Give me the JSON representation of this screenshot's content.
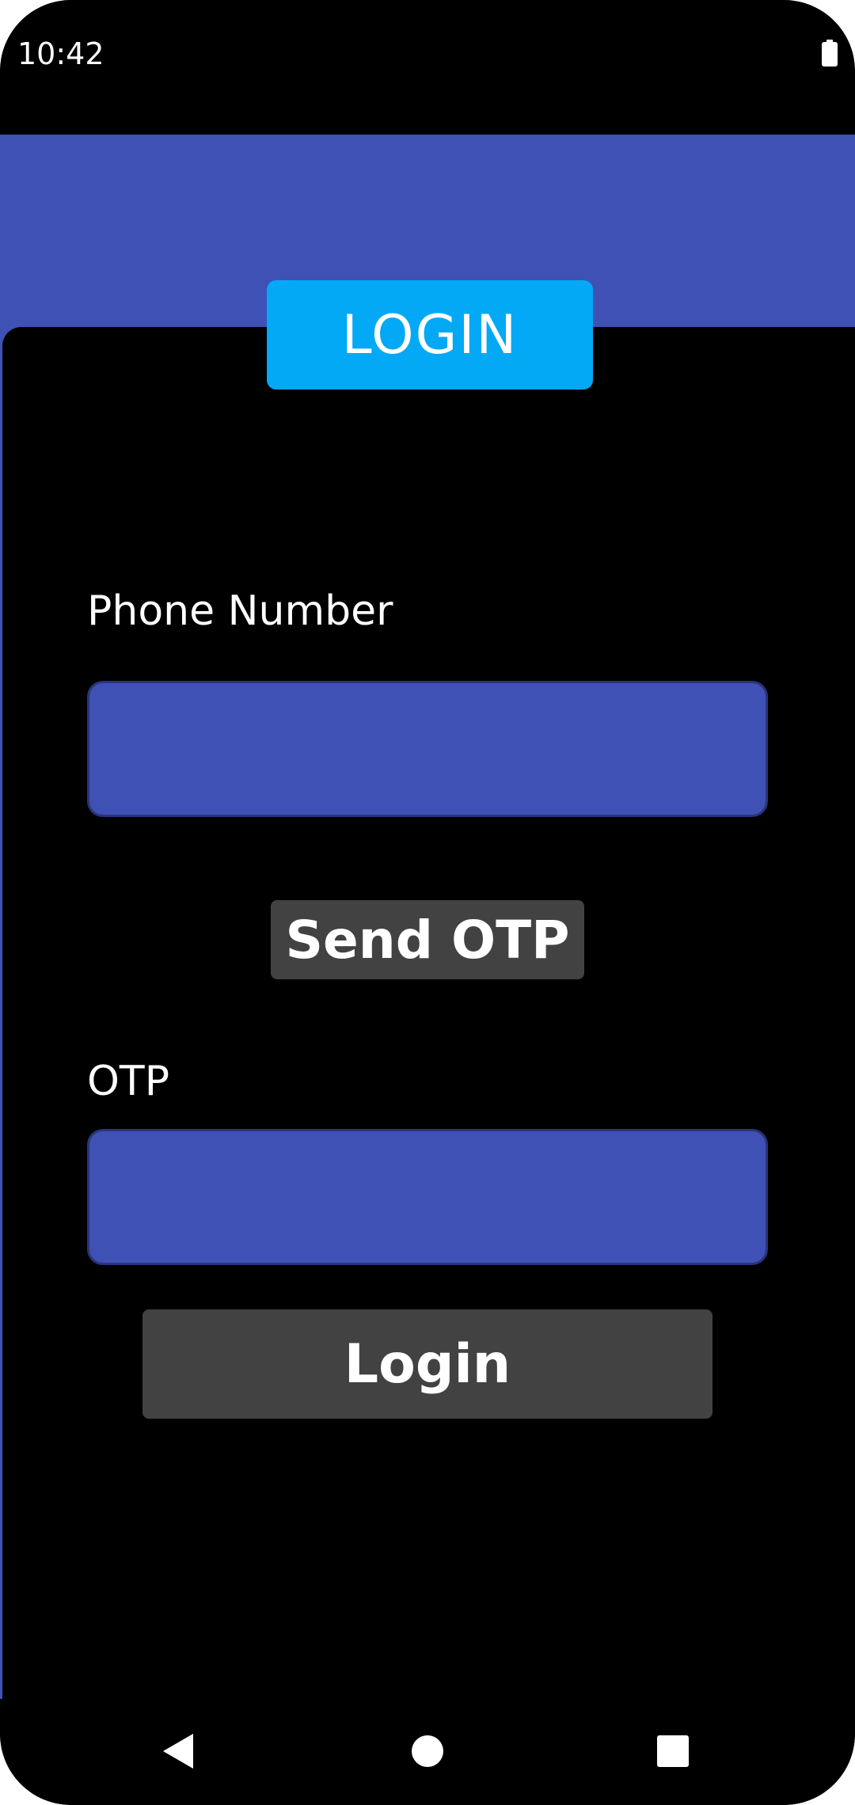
{
  "status_bar": {
    "time": "10:42",
    "battery_icon": "battery-full-icon"
  },
  "screen": {
    "title": "LOGIN",
    "phone": {
      "label": "Phone Number",
      "value": "",
      "placeholder": ""
    },
    "send_otp_label": "Send OTP",
    "otp": {
      "label": "OTP",
      "value": "",
      "placeholder": ""
    },
    "login_label": "Login"
  },
  "nav_bar": {
    "back_icon": "back-triangle-icon",
    "home_icon": "home-circle-icon",
    "recents_icon": "recents-square-icon"
  },
  "colors": {
    "primary": "#3f51b5",
    "accent": "#03a9f4",
    "button": "#424242",
    "background": "#000000",
    "text": "#ffffff"
  }
}
